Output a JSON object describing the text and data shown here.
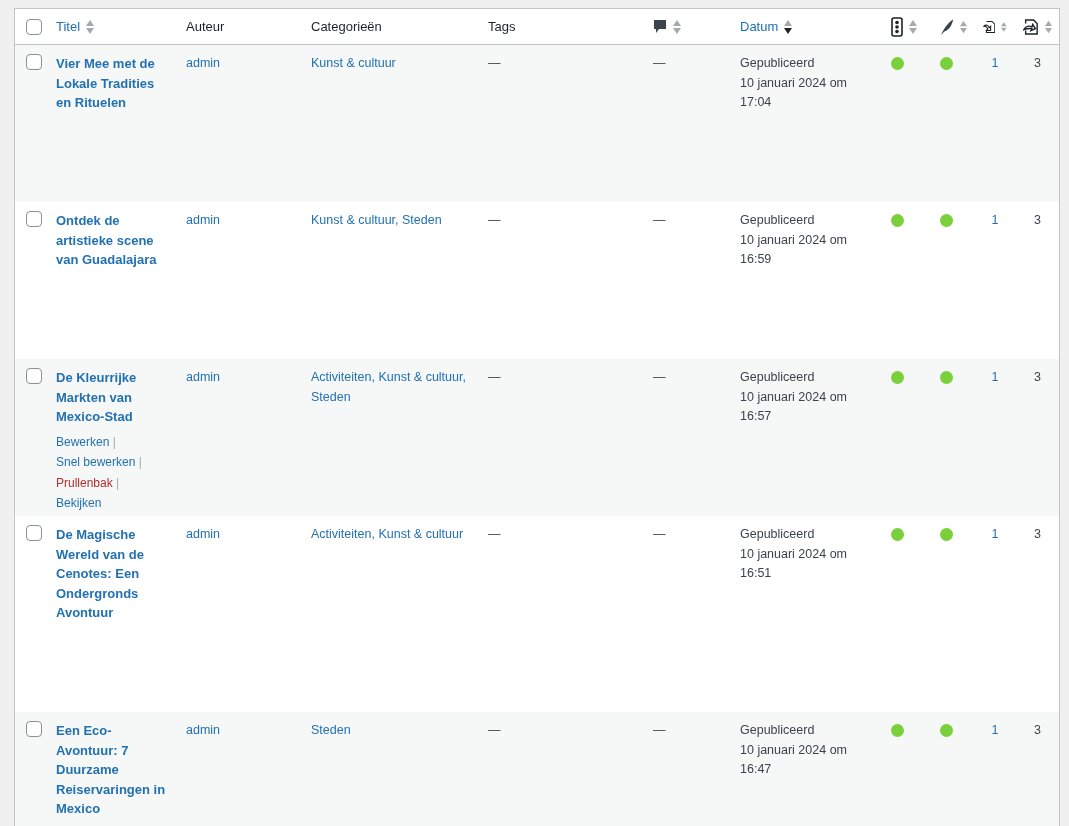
{
  "table": {
    "columns": [
      {
        "kind": "checkbox",
        "checked": false
      },
      {
        "kind": "sortable",
        "label": "Titel",
        "sorted": false
      },
      {
        "kind": "plain",
        "label": "Auteur"
      },
      {
        "kind": "plain",
        "label": "Categorieën"
      },
      {
        "kind": "plain",
        "label": "Tags"
      },
      {
        "kind": "comment-icon",
        "sorted": false
      },
      {
        "kind": "sortable",
        "label": "Datum",
        "sorted": true
      },
      {
        "kind": "traffic-light-icon",
        "sorted": false
      },
      {
        "kind": "feather-icon",
        "sorted": false
      },
      {
        "kind": "incoming-link-icon",
        "sorted": false
      },
      {
        "kind": "outgoing-link-icon",
        "sorted": false
      }
    ],
    "rows": [
      {
        "checked": false,
        "title": "Vier Mee met de Lokale Tradities en Rituelen",
        "author": "admin",
        "categories": "Kunst & cultuur",
        "tags": "—",
        "comments": "—",
        "status": "Gepubliceerd",
        "date": "10 januari 2024 om 17:04",
        "seo": {
          "color": "#7ad03a"
        },
        "readability": {
          "color": "#7ad03a"
        },
        "incoming": "1",
        "outgoing": "3",
        "actions": []
      },
      {
        "checked": false,
        "title": "Ontdek de artistieke scene van Guadalajara",
        "author": "admin",
        "categories": "Kunst & cultuur, Steden",
        "tags": "—",
        "comments": "—",
        "status": "Gepubliceerd",
        "date": "10 januari 2024 om 16:59",
        "seo": {
          "color": "#7ad03a"
        },
        "readability": {
          "color": "#7ad03a"
        },
        "incoming": "1",
        "outgoing": "3",
        "actions": []
      },
      {
        "checked": false,
        "title": "De Kleurrijke Markten van Mexico-Stad",
        "author": "admin",
        "categories": "Activiteiten, Kunst & cultuur, Steden",
        "tags": "—",
        "comments": "—",
        "status": "Gepubliceerd",
        "date": "10 januari 2024 om 16:57",
        "seo": {
          "color": "#7ad03a"
        },
        "readability": {
          "color": "#7ad03a"
        },
        "incoming": "1",
        "outgoing": "3",
        "actions": [
          {
            "label": "Bewerken",
            "kind": "normal",
            "separator": "|"
          },
          {
            "label": "Snel bewerken",
            "kind": "normal",
            "separator": "|"
          },
          {
            "label": "Prullenbak",
            "kind": "danger",
            "separator": "|"
          },
          {
            "label": "Bekijken",
            "kind": "normal"
          }
        ]
      },
      {
        "checked": false,
        "title": "De Magische Wereld van de Cenotes: Een Ondergronds Avontuur",
        "author": "admin",
        "categories": "Activiteiten, Kunst & cultuur",
        "tags": "—",
        "comments": "—",
        "status": "Gepubliceerd",
        "date": "10 januari 2024 om 16:51",
        "seo": {
          "color": "#7ad03a"
        },
        "readability": {
          "color": "#7ad03a"
        },
        "incoming": "1",
        "outgoing": "3",
        "actions": []
      },
      {
        "checked": false,
        "title": "Een Eco-Avontuur: 7 Duurzame Reiservaringen in Mexico",
        "author": "admin",
        "categories": "Steden",
        "tags": "—",
        "comments": "—",
        "status": "Gepubliceerd",
        "date": "10 januari 2024 om 16:47",
        "seo": {
          "color": "#7ad03a"
        },
        "readability": {
          "color": "#7ad03a"
        },
        "incoming": "1",
        "outgoing": "3",
        "actions": []
      }
    ]
  }
}
